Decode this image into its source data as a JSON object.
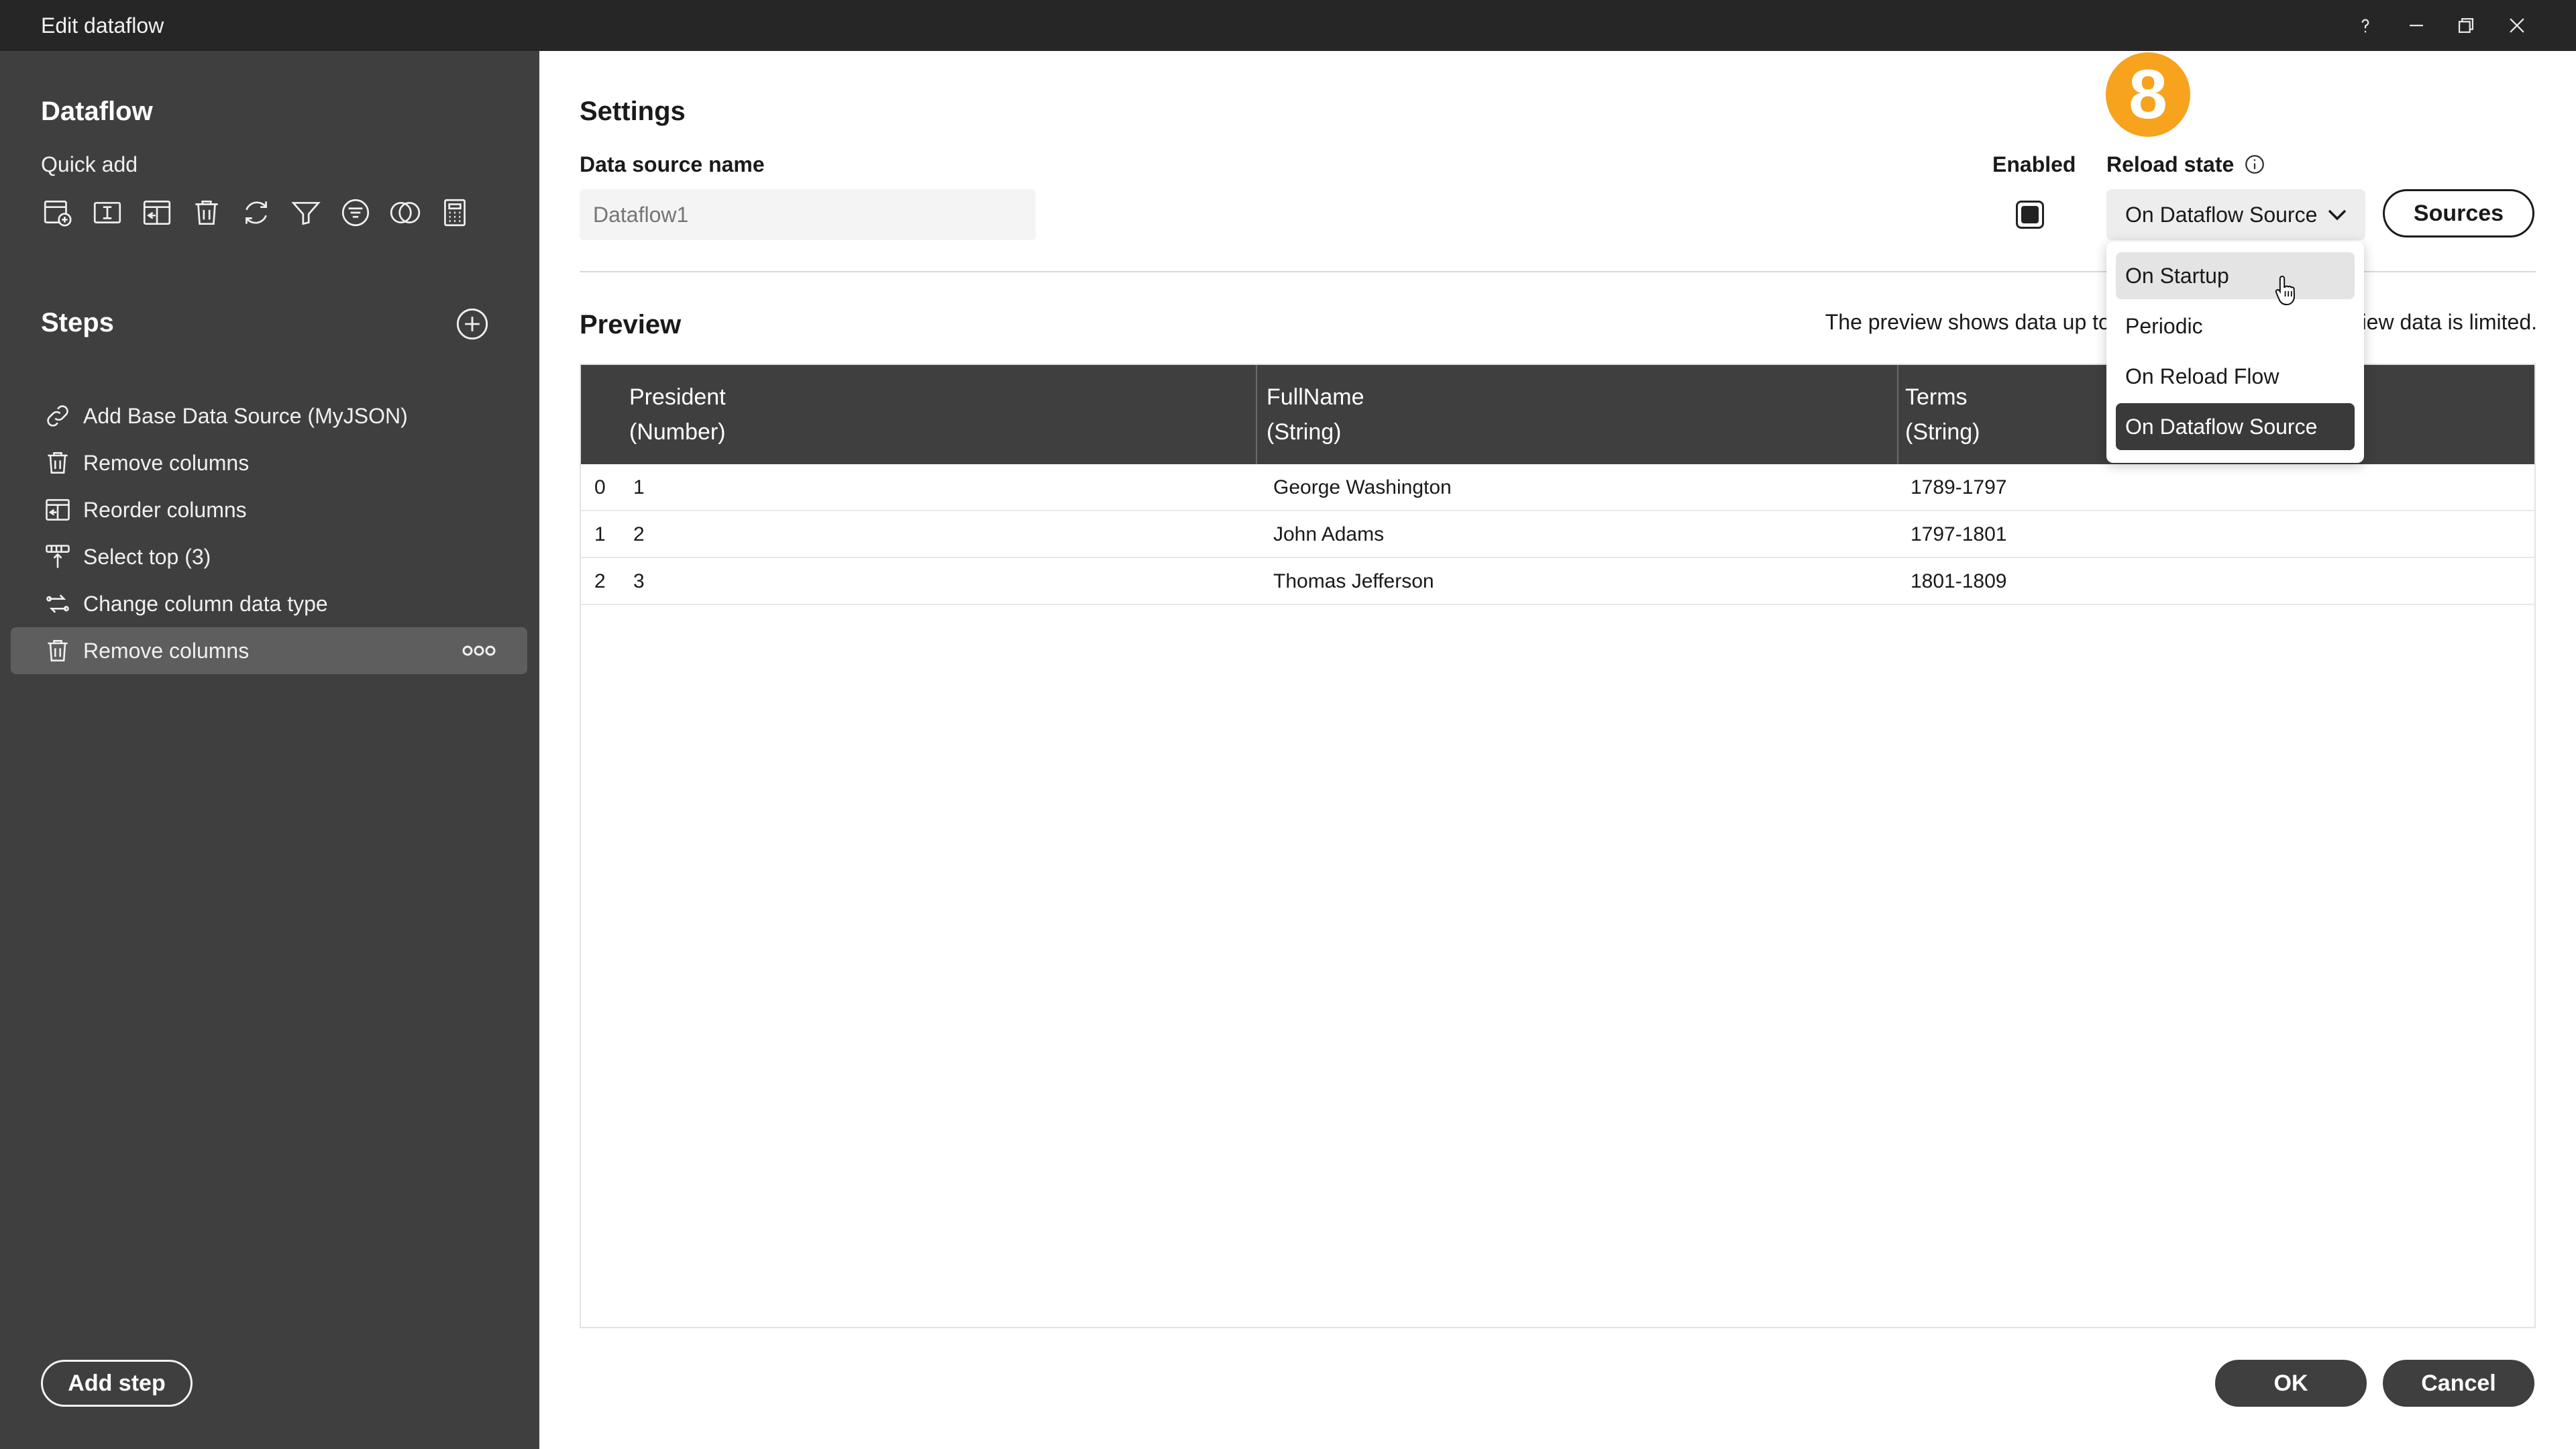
{
  "window": {
    "title": "Edit dataflow",
    "controls": [
      "help-icon",
      "minimize-icon",
      "restore-icon",
      "close-icon"
    ]
  },
  "sidebar": {
    "title": "Dataflow",
    "quick_add_label": "Quick add",
    "quick_add_icons": [
      "add-data-source-icon",
      "text-field-icon",
      "reorder-columns-icon",
      "trash-icon",
      "refresh-icon",
      "filter-icon",
      "list-filter-icon",
      "join-icon",
      "calculator-icon"
    ],
    "steps_title": "Steps",
    "steps": [
      {
        "label": "Add Base Data Source (MyJSON)",
        "icon": "link-icon"
      },
      {
        "label": "Remove columns",
        "icon": "trash-icon"
      },
      {
        "label": "Reorder columns",
        "icon": "reorder-columns-icon"
      },
      {
        "label": "Select top (3)",
        "icon": "select-top-icon"
      },
      {
        "label": "Change column data type",
        "icon": "convert-icon"
      },
      {
        "label": "Remove columns",
        "icon": "trash-icon",
        "selected": true
      }
    ],
    "add_step_label": "Add step"
  },
  "settings": {
    "title": "Settings",
    "data_source_label": "Data source name",
    "data_source_placeholder": "Dataflow1",
    "enabled_label": "Enabled",
    "enabled": true,
    "reload_state_label": "Reload state",
    "reload_state_value": "On Dataflow Source",
    "sources_label": "Sources",
    "step_badge": "8"
  },
  "preview": {
    "title": "Preview",
    "note": "The preview shows data up to the current step. The preview data is limited.",
    "columns": [
      {
        "name": "President",
        "type": "(Number)"
      },
      {
        "name": "FullName",
        "type": "(String)"
      },
      {
        "name": "Terms",
        "type": "(String)"
      }
    ],
    "rows": [
      {
        "index": "0",
        "president": "1",
        "fullname": "George Washington",
        "terms": "1789-1797"
      },
      {
        "index": "1",
        "president": "2",
        "fullname": "John Adams",
        "terms": "1797-1801"
      },
      {
        "index": "2",
        "president": "3",
        "fullname": "Thomas Jefferson",
        "terms": "1801-1809"
      }
    ]
  },
  "reload_dropdown": {
    "options": [
      "On Startup",
      "Periodic",
      "On Reload Flow",
      "On Dataflow Source"
    ],
    "hovered": "On Startup",
    "selected": "On Dataflow Source"
  },
  "footer": {
    "ok_label": "OK",
    "cancel_label": "Cancel"
  },
  "colors": {
    "titlebar": "#262626",
    "sidebar": "#3f3f3f",
    "badge": "#f7a31e",
    "table_header": "#3f3f3f"
  }
}
